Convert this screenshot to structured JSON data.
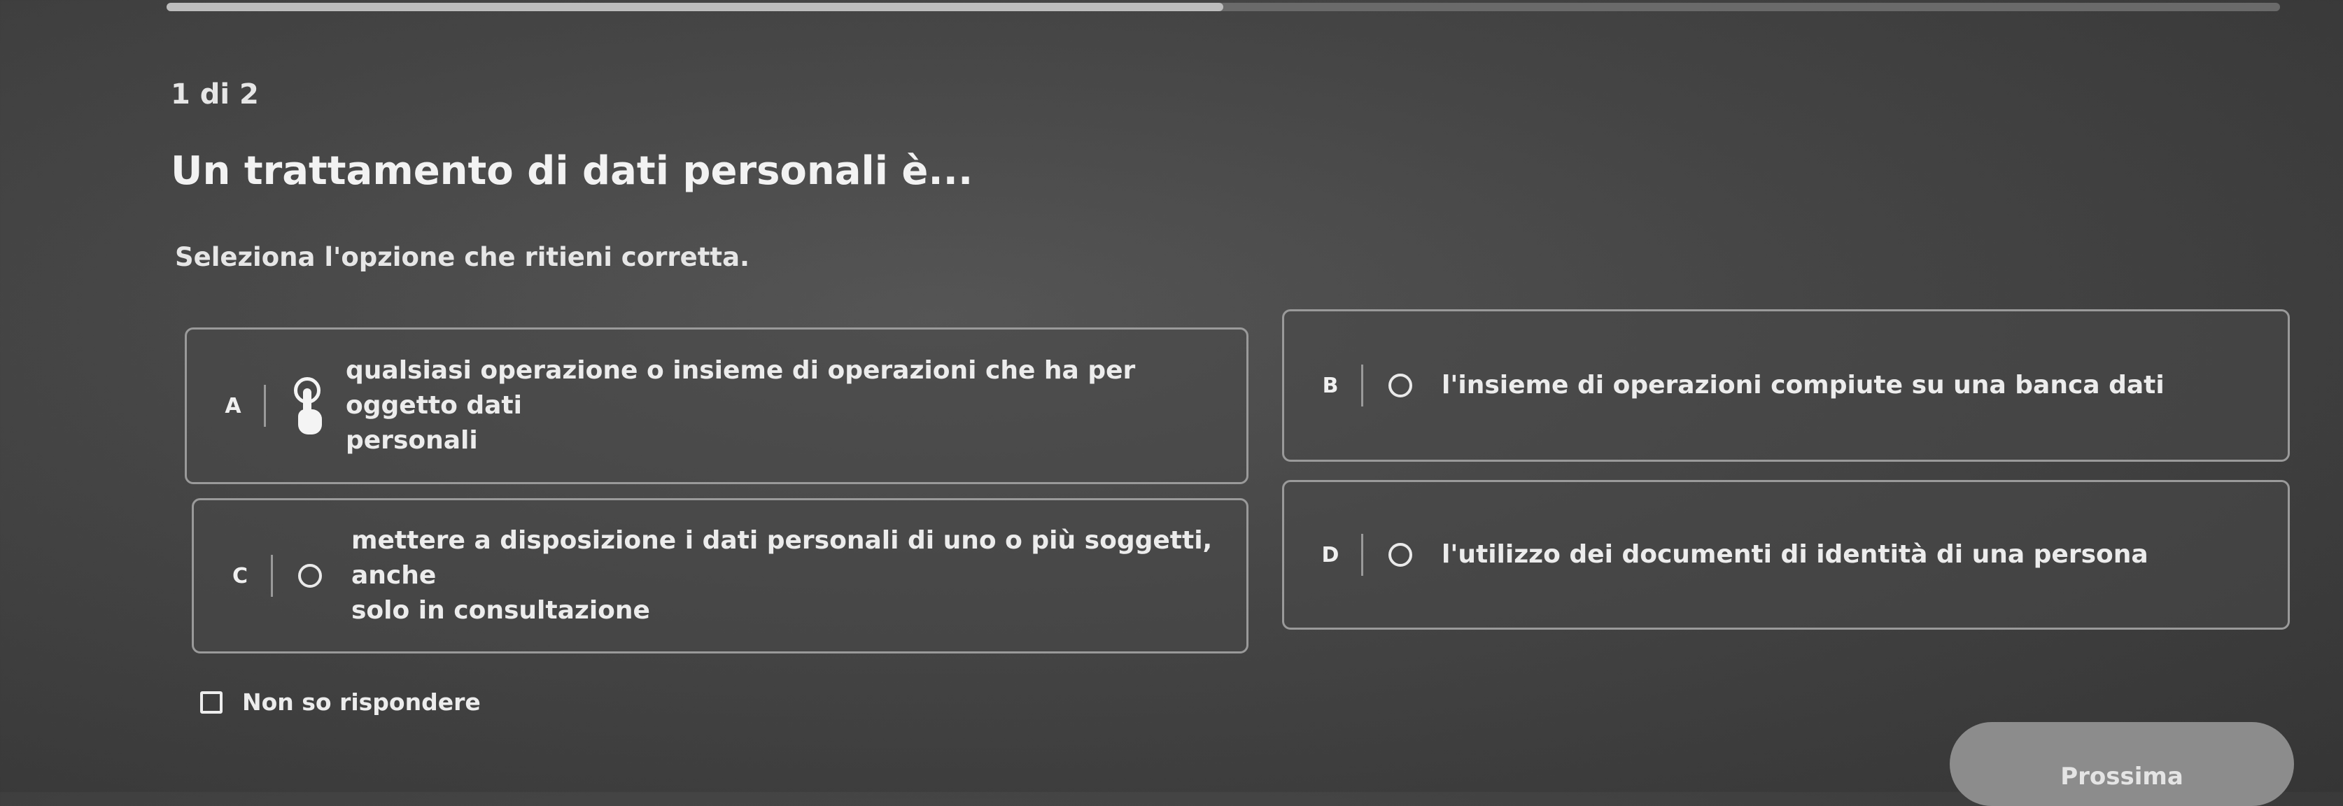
{
  "quiz": {
    "progress": 0.5,
    "counter": "1 di 2",
    "question": "Un trattamento di dati personali è...",
    "instruction": "Seleziona l'opzione che ritieni corretta.",
    "options": [
      {
        "letter": "A",
        "line1": "qualsiasi operazione o insieme di operazioni che ha per oggetto dati",
        "line2": "personali",
        "state": "hovered"
      },
      {
        "letter": "B",
        "line1": "l'insieme di operazioni compiute su una banca dati",
        "line2": ""
      },
      {
        "letter": "C",
        "line1": "mettere a disposizione i dati personali di uno o più soggetti, anche",
        "line2": "solo in consultazione"
      },
      {
        "letter": "D",
        "line1": "l'utilizzo dei documenti di identità di una persona",
        "line2": ""
      }
    ],
    "unsure_label": "Non so rispondere",
    "next_label": "Prossima"
  },
  "icons": {
    "option_a": "pointer-hand-icon",
    "option_radio": "radio-circle-icon",
    "unsure": "checkbox-icon"
  },
  "colors": {
    "background": "#474747",
    "border": "#9a9a9a",
    "text": "#ececec",
    "button": "#8c8c8c"
  }
}
